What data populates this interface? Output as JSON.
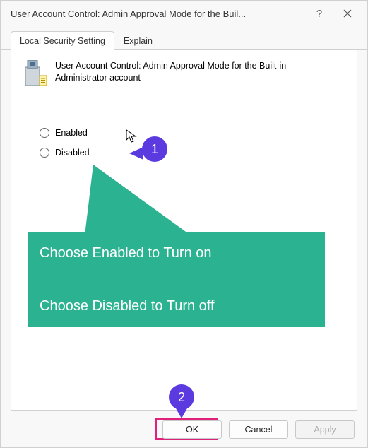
{
  "titlebar": {
    "title": "User Account Control: Admin Approval Mode for the Buil..."
  },
  "tabs": {
    "local": "Local Security Setting",
    "explain": "Explain"
  },
  "policy": {
    "title": "User Account Control: Admin Approval Mode for the Built-in Administrator account"
  },
  "radios": {
    "enabled": "Enabled",
    "disabled": "Disabled"
  },
  "annotations": {
    "step1": "1",
    "step2": "2",
    "callout_line1": "Choose Enabled to Turn on",
    "callout_line2": "Choose Disabled to Turn off"
  },
  "buttons": {
    "ok": "OK",
    "cancel": "Cancel",
    "apply": "Apply"
  }
}
